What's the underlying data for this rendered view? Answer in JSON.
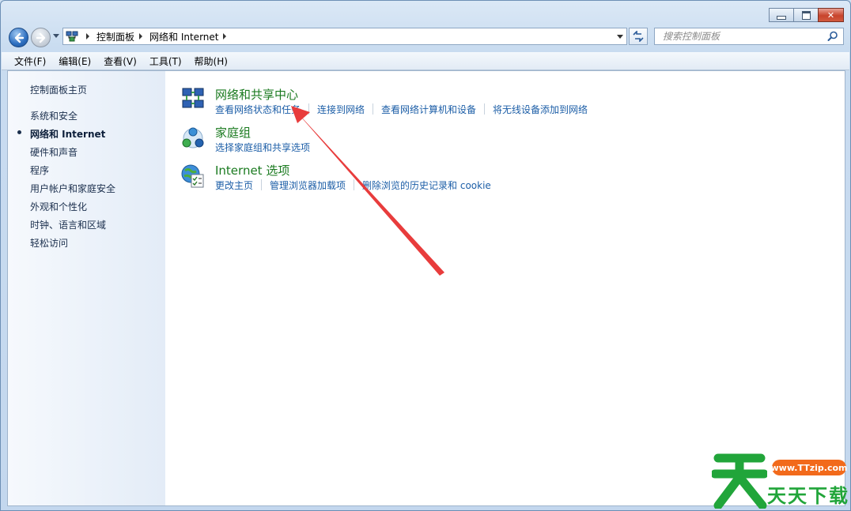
{
  "window": {
    "caption_buttons": [
      "minimize",
      "maximize",
      "close"
    ]
  },
  "address": {
    "crumbs": [
      "控制面板",
      "网络和 Internet"
    ]
  },
  "search": {
    "placeholder": "搜索控制面板"
  },
  "menu": [
    "文件(F)",
    "编辑(E)",
    "查看(V)",
    "工具(T)",
    "帮助(H)"
  ],
  "sidebar": {
    "items": [
      {
        "label": "控制面板主页"
      },
      {
        "label": "系统和安全"
      },
      {
        "label": "网络和 Internet",
        "current": true
      },
      {
        "label": "硬件和声音"
      },
      {
        "label": "程序"
      },
      {
        "label": "用户帐户和家庭安全"
      },
      {
        "label": "外观和个性化"
      },
      {
        "label": "时钟、语言和区域"
      },
      {
        "label": "轻松访问"
      }
    ]
  },
  "categories": [
    {
      "title": "网络和共享中心",
      "icon": "network-sharing-icon",
      "links": [
        "查看网络状态和任务",
        "连接到网络",
        "查看网络计算机和设备",
        "将无线设备添加到网络"
      ]
    },
    {
      "title": "家庭组",
      "icon": "homegroup-icon",
      "links": [
        "选择家庭组和共享选项"
      ]
    },
    {
      "title": "Internet 选项",
      "icon": "internet-options-icon",
      "links": [
        "更改主页",
        "管理浏览器加载项",
        "删除浏览的历史记录和 cookie"
      ]
    }
  ],
  "watermark": {
    "url": "www.TTzip.com",
    "text": "天天下载"
  },
  "colors": {
    "link": "#1c5ea7",
    "category_title": "#1a7a1f",
    "arrow": "#e83c3c"
  }
}
